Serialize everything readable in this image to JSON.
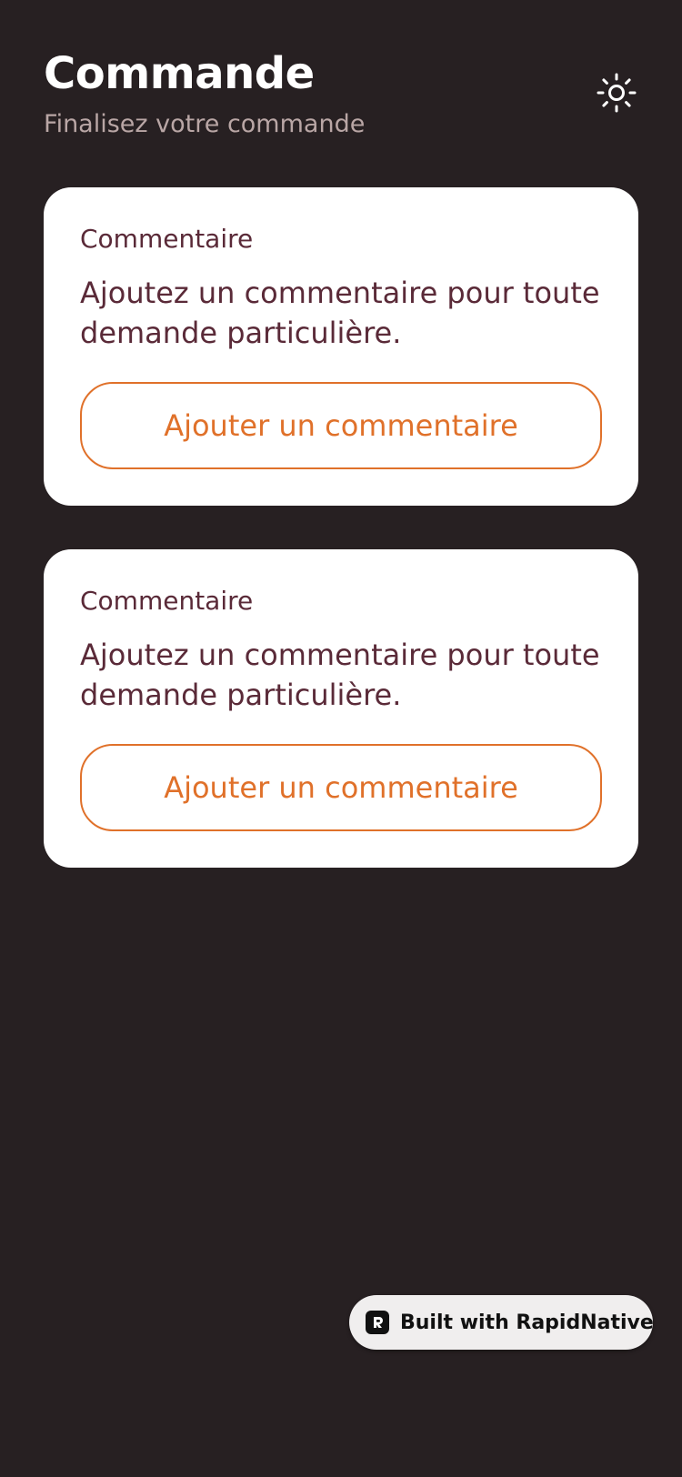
{
  "header": {
    "title": "Commande",
    "subtitle": "Finalisez votre commande",
    "theme_icon": "sun-icon"
  },
  "cards": [
    {
      "label": "Commentaire",
      "description": "Ajoutez un commentaire pour toute demande particulière.",
      "button_label": "Ajouter un commentaire"
    },
    {
      "label": "Commentaire",
      "description": "Ajoutez un commentaire pour toute demande particulière.",
      "button_label": "Ajouter un commentaire"
    }
  ],
  "badge": {
    "text": "Built with RapidNative",
    "icon": "rapidnative-logo-icon"
  },
  "colors": {
    "background": "#272022",
    "card": "#ffffff",
    "accent": "#e0712a",
    "text_dark": "#5a2a38",
    "subtitle": "#b9a6a5"
  }
}
